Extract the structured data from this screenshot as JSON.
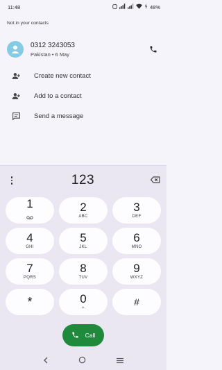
{
  "status_bar": {
    "time": "11:48",
    "battery": "48%"
  },
  "section_label": "Not in your contacts",
  "contact": {
    "number": "0312 3243053",
    "subtitle": "Pakistan • 6 May"
  },
  "actions": [
    {
      "label": "Create new contact",
      "icon": "person-add-icon"
    },
    {
      "label": "Add to a contact",
      "icon": "person-add-icon"
    },
    {
      "label": "Send a message",
      "icon": "message-icon"
    }
  ],
  "dialer": {
    "digits": "123"
  },
  "keys": [
    {
      "num": "1",
      "sub": ""
    },
    {
      "num": "2",
      "sub": "ABC"
    },
    {
      "num": "3",
      "sub": "DEF"
    },
    {
      "num": "4",
      "sub": "GHI"
    },
    {
      "num": "5",
      "sub": "JKL"
    },
    {
      "num": "6",
      "sub": "MNO"
    },
    {
      "num": "7",
      "sub": "PQRS"
    },
    {
      "num": "8",
      "sub": "TUV"
    },
    {
      "num": "9",
      "sub": "WXYZ"
    },
    {
      "num": "*",
      "sub": ""
    },
    {
      "num": "0",
      "sub": "+"
    },
    {
      "num": "#",
      "sub": ""
    }
  ],
  "call_button": {
    "label": "Call",
    "color": "#1f8a3b"
  },
  "colors": {
    "accent": "#1f8a3b",
    "avatar": "#84cbe3",
    "dialpad_bg": "#eae6f2"
  }
}
